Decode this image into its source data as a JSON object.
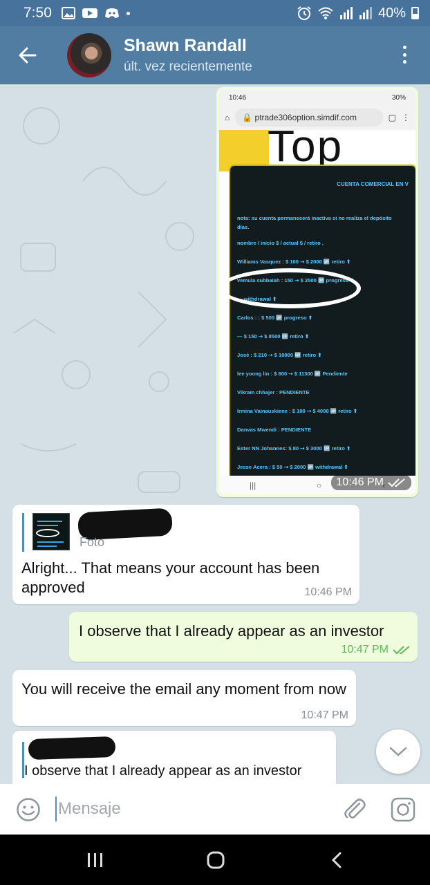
{
  "status_bar": {
    "time": "7:50",
    "left_icons": [
      "image-icon",
      "play-store-icon",
      "discord-icon",
      "dot-icon"
    ],
    "battery": "40%"
  },
  "header": {
    "contact_name": "Shawn Randall",
    "contact_status": "últ. vez recientemente"
  },
  "photo_message": {
    "time": "10:46 PM",
    "screenshot": {
      "status_time": "10:46",
      "status_battery": "30%",
      "url": "ptrade306option.simdif.com",
      "heading": "Top",
      "board_title": "CUENTA COMERCIAL EN V",
      "rows": [
        "nota: su cuenta permanecerá inactiva si no realiza el depósito",
        "días.",
        "nombre / inicio $ / actual $ / retiro .",
        "Williams Vasquez : $ 100 ⇢ $ 2000 🆙 retiro ⬆",
        "vemula subbaiah : 150 ⇢ $ 2500 🆙 progress ⬆",
        "— withdrawal ⬆",
        "Carlos :         : $ 500 🆙 progreso ⬆",
        "— $ 150 ⇢ $ 8500 🆙 retiro ⬆",
        "José : $ 210 ⇢ $ 10000 🆙 retiro ⬆",
        "lee yoong lin : $ 800 ⇢ $ 11300 🆙 Pendiente",
        "Vikram chhajer : PENDIENTE",
        "Irmina Vainauskiene : $ 100 ⇢ $ 4000 🆙 retiro ⬆",
        "Danvas Mwendi : PENDIENTE",
        "Ester NN Johannes: $ 80 ⇢ $ 3000 🆙 retiro ⬆",
        "Jesse Acera : $ 50 ⇢ $ 2000 🆙 withdrawal ⬆"
      ]
    }
  },
  "messages": [
    {
      "id": "m1",
      "dir": "in",
      "reply_label": "Foto",
      "text": "Alright... That means your account has been approved",
      "time": "10:46 PM"
    },
    {
      "id": "m2",
      "dir": "out",
      "text": "I observe that I already appear as an investor",
      "time": "10:47 PM"
    },
    {
      "id": "m3",
      "dir": "in",
      "text": "You will receive the email any moment from now",
      "time": "10:47 PM"
    },
    {
      "id": "m4",
      "dir": "in",
      "reply_text": "I observe that I already appear as an investor"
    }
  ],
  "input": {
    "placeholder": "Mensaje"
  },
  "colors": {
    "header": "#517da2",
    "status_bar": "#46729c",
    "outgoing_bubble": "#effdde",
    "incoming_bubble": "#ffffff",
    "check_marks": "#5fb85a",
    "chat_bg": "#d4dfe6"
  }
}
